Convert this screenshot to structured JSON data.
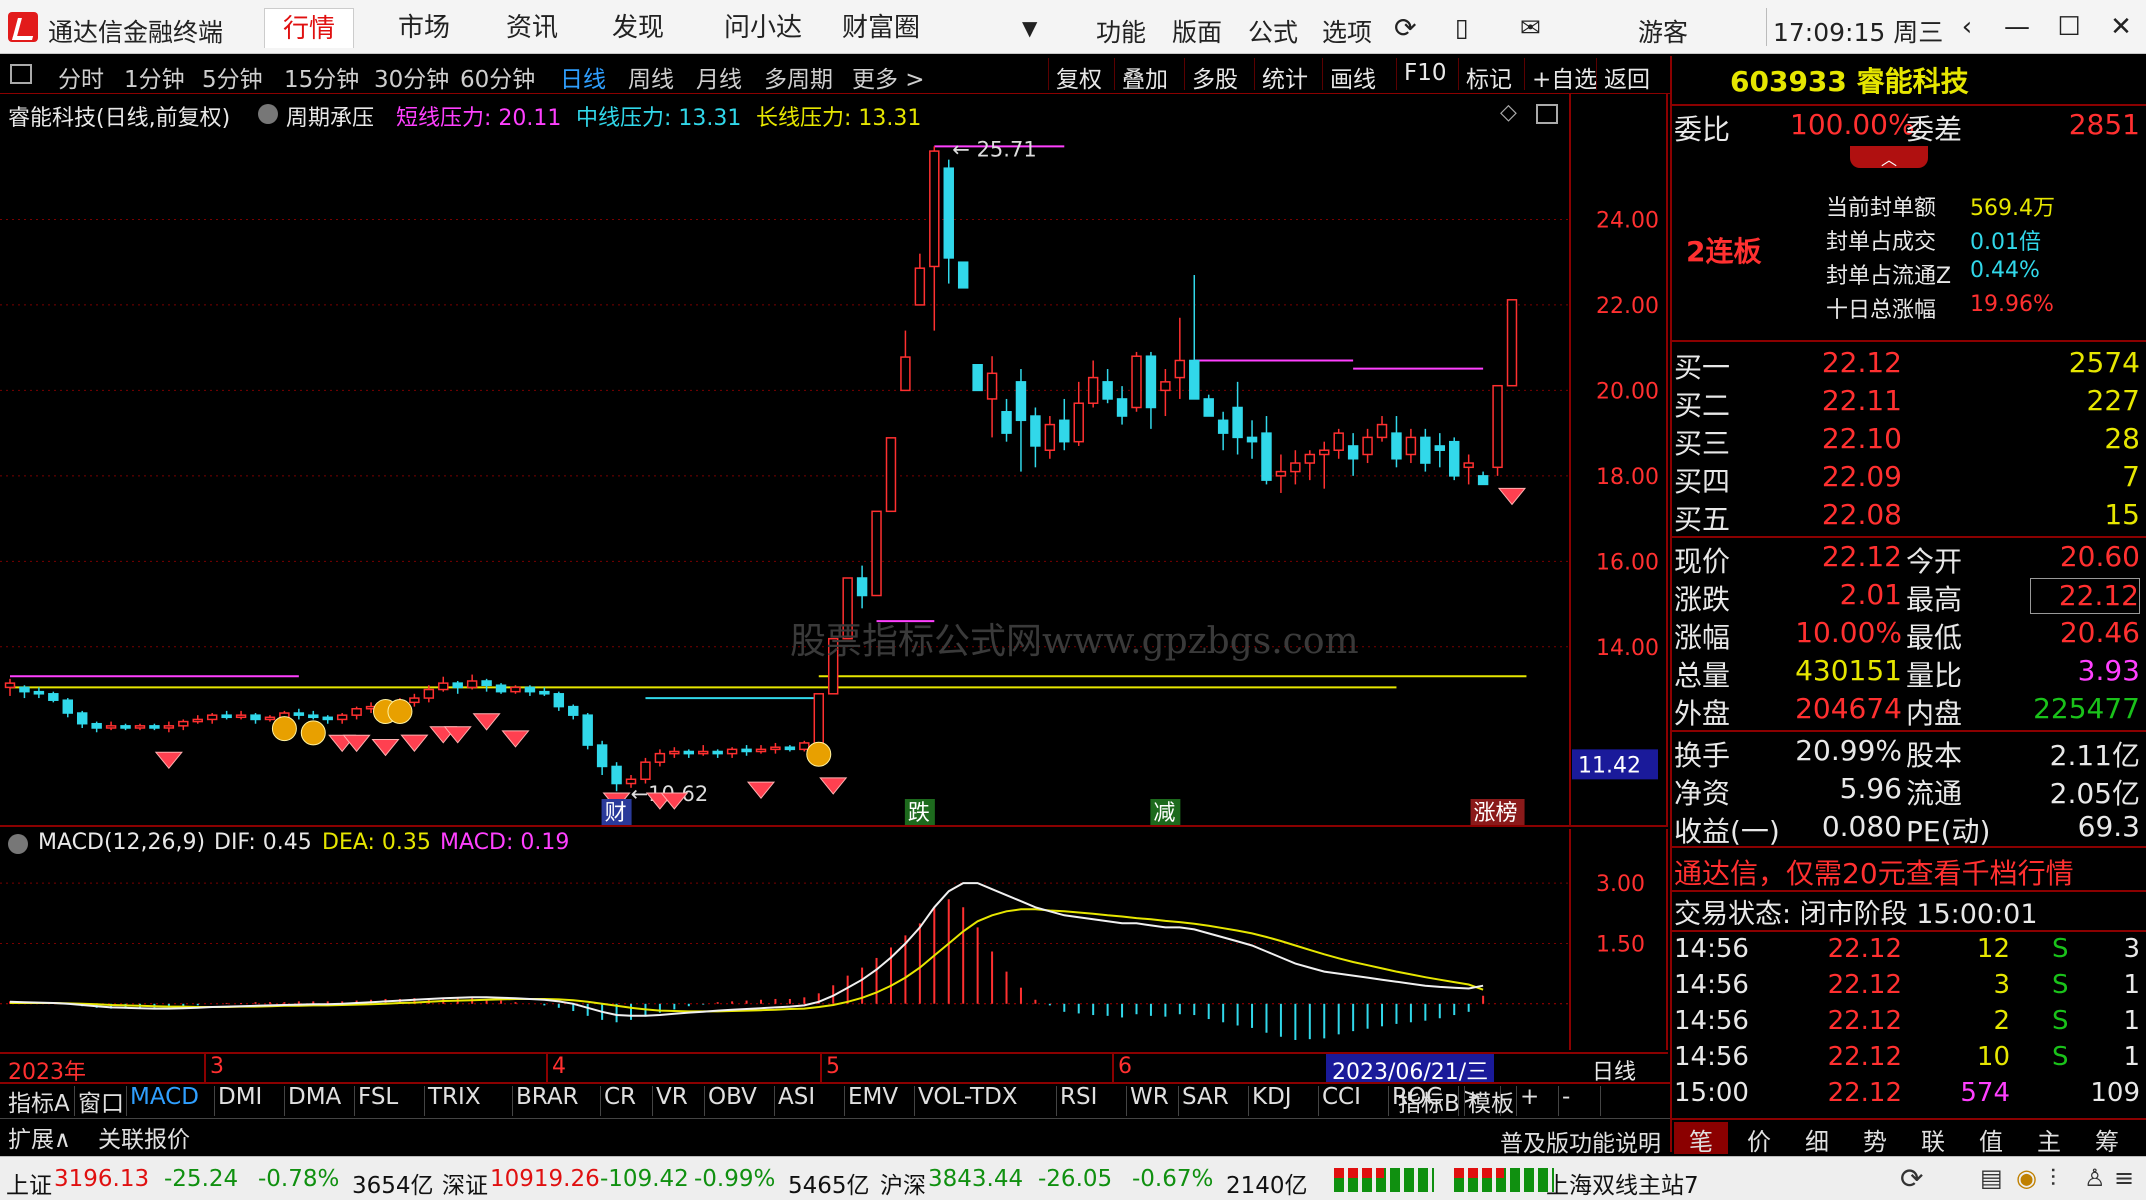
{
  "window": {
    "app_title": "通达信金融终端",
    "menu_tabs": [
      "行情",
      "市场",
      "资讯",
      "发现",
      "问小达",
      "财富圈"
    ],
    "active_tab": "行情",
    "tools": [
      "功能",
      "版面",
      "公式",
      "选项"
    ],
    "user": "游客",
    "clock": "17:09:15 周三"
  },
  "periods": [
    "分时",
    "1分钟",
    "5分钟",
    "15分钟",
    "30分钟",
    "60分钟",
    "日线",
    "周线",
    "月线",
    "多周期",
    "更多 >"
  ],
  "active_period": "日线",
  "toolbar_right": [
    "复权",
    "叠加",
    "多股",
    "统计",
    "画线",
    "F10",
    "标记",
    "+自选",
    "返回"
  ],
  "chart_header": {
    "name": "睿能科技(日线,前复权)",
    "indicator": "周期承压",
    "short_label": "短线压力: 20.11",
    "mid_label": "中线压力: 13.31",
    "long_label": "长线压力: 13.31"
  },
  "chart_data": [
    {
      "type": "candlestick",
      "title": "睿能科技(日线,前复权)",
      "y_ticks": [
        "24.00",
        "22.00",
        "20.00",
        "18.00",
        "16.00",
        "14.00"
      ],
      "ylim": [
        9.9,
        26.0
      ],
      "annotations": {
        "high": "25.71",
        "low": "10.62",
        "current_axis": "11.42"
      },
      "x_ticks": [
        "2023年",
        "3",
        "4",
        "5",
        "6"
      ],
      "cursor_date": "2023/06/21/三",
      "event_tags": [
        "财",
        "跌",
        "减",
        "涨榜"
      ],
      "pressure_lines": {
        "short": 20.11,
        "mid": 13.31,
        "long": 13.31
      },
      "candles": [
        [
          13.05,
          13.15,
          12.85,
          13.25
        ],
        [
          13.05,
          12.95,
          12.8,
          13.1
        ],
        [
          12.95,
          12.9,
          12.8,
          13.05
        ],
        [
          12.9,
          12.75,
          12.7,
          12.95
        ],
        [
          12.75,
          12.45,
          12.35,
          12.8
        ],
        [
          12.45,
          12.2,
          12.1,
          12.5
        ],
        [
          12.2,
          12.1,
          12.0,
          12.25
        ],
        [
          12.1,
          12.15,
          12.05,
          12.25
        ],
        [
          12.15,
          12.1,
          12.05,
          12.2
        ],
        [
          12.1,
          12.15,
          12.05,
          12.2
        ],
        [
          12.15,
          12.1,
          12.05,
          12.2
        ],
        [
          12.1,
          12.15,
          12.0,
          12.25
        ],
        [
          12.15,
          12.25,
          12.05,
          12.3
        ],
        [
          12.25,
          12.3,
          12.2,
          12.4
        ],
        [
          12.3,
          12.4,
          12.2,
          12.45
        ],
        [
          12.4,
          12.35,
          12.3,
          12.5
        ],
        [
          12.35,
          12.4,
          12.3,
          12.5
        ],
        [
          12.4,
          12.3,
          12.2,
          12.45
        ],
        [
          12.3,
          12.35,
          12.25,
          12.4
        ],
        [
          12.35,
          12.45,
          12.3,
          12.5
        ],
        [
          12.45,
          12.4,
          12.3,
          12.55
        ],
        [
          12.4,
          12.35,
          12.3,
          12.5
        ],
        [
          12.35,
          12.3,
          12.2,
          12.4
        ],
        [
          12.3,
          12.4,
          12.2,
          12.45
        ],
        [
          12.4,
          12.55,
          12.3,
          12.6
        ],
        [
          12.55,
          12.6,
          12.45,
          12.7
        ],
        [
          12.6,
          12.55,
          12.45,
          12.65
        ],
        [
          12.55,
          12.7,
          12.5,
          12.8
        ],
        [
          12.7,
          12.8,
          12.6,
          12.9
        ],
        [
          12.8,
          13.0,
          12.7,
          13.1
        ],
        [
          13.0,
          13.15,
          12.95,
          13.3
        ],
        [
          13.15,
          13.05,
          12.9,
          13.2
        ],
        [
          13.05,
          13.2,
          13.0,
          13.35
        ],
        [
          13.2,
          13.1,
          12.95,
          13.25
        ],
        [
          13.1,
          12.95,
          12.9,
          13.15
        ],
        [
          12.95,
          13.05,
          12.9,
          13.1
        ],
        [
          13.05,
          12.95,
          12.85,
          13.1
        ],
        [
          12.95,
          12.9,
          12.85,
          13.05
        ],
        [
          12.9,
          12.6,
          12.5,
          12.95
        ],
        [
          12.6,
          12.4,
          12.3,
          12.65
        ],
        [
          12.4,
          11.7,
          11.6,
          12.45
        ],
        [
          11.7,
          11.2,
          11.0,
          11.8
        ],
        [
          11.2,
          10.8,
          10.62,
          11.3
        ],
        [
          10.8,
          10.9,
          10.7,
          11.0
        ],
        [
          10.9,
          11.3,
          10.8,
          11.4
        ],
        [
          11.3,
          11.5,
          11.2,
          11.6
        ],
        [
          11.5,
          11.55,
          11.4,
          11.65
        ],
        [
          11.55,
          11.5,
          11.4,
          11.6
        ],
        [
          11.5,
          11.55,
          11.45,
          11.7
        ],
        [
          11.55,
          11.5,
          11.4,
          11.6
        ],
        [
          11.5,
          11.6,
          11.4,
          11.65
        ],
        [
          11.6,
          11.55,
          11.45,
          11.7
        ],
        [
          11.55,
          11.6,
          11.5,
          11.7
        ],
        [
          11.6,
          11.65,
          11.5,
          11.75
        ],
        [
          11.65,
          11.6,
          11.55,
          11.7
        ],
        [
          11.6,
          11.75,
          11.55,
          11.8
        ],
        [
          11.75,
          12.9,
          11.7,
          12.9
        ],
        [
          12.9,
          14.19,
          12.9,
          14.19
        ],
        [
          14.19,
          15.61,
          15.61,
          15.61
        ],
        [
          15.61,
          15.2,
          14.9,
          15.9
        ],
        [
          15.2,
          17.17,
          17.17,
          17.17
        ],
        [
          17.17,
          18.89,
          18.89,
          18.89
        ],
        [
          20.0,
          20.78,
          20.3,
          21.4
        ],
        [
          22.0,
          22.86,
          22.0,
          23.2
        ],
        [
          22.9,
          25.6,
          21.4,
          25.71
        ],
        [
          25.2,
          23.1,
          22.5,
          25.4
        ],
        [
          23.0,
          22.4,
          22.4,
          22.4
        ],
        [
          20.6,
          20.0,
          20.0,
          20.0
        ],
        [
          19.8,
          20.4,
          18.9,
          20.8
        ],
        [
          19.5,
          19.0,
          18.8,
          19.8
        ],
        [
          20.2,
          19.3,
          18.1,
          20.5
        ],
        [
          19.4,
          18.7,
          18.2,
          19.6
        ],
        [
          18.6,
          19.2,
          18.4,
          19.4
        ],
        [
          19.3,
          18.8,
          18.6,
          19.8
        ],
        [
          18.8,
          19.7,
          18.7,
          20.2
        ],
        [
          19.7,
          20.3,
          19.6,
          20.7
        ],
        [
          20.2,
          19.8,
          19.7,
          20.5
        ],
        [
          19.8,
          19.4,
          19.2,
          20.1
        ],
        [
          19.6,
          20.8,
          19.5,
          20.9
        ],
        [
          20.8,
          19.6,
          19.1,
          20.9
        ],
        [
          20.0,
          20.2,
          19.4,
          20.5
        ],
        [
          20.3,
          20.7,
          19.8,
          21.7
        ],
        [
          20.7,
          19.8,
          19.8,
          22.7
        ],
        [
          19.8,
          19.4,
          19.4,
          19.9
        ],
        [
          19.3,
          19.0,
          18.6,
          19.5
        ],
        [
          19.6,
          18.9,
          18.5,
          20.2
        ],
        [
          18.9,
          18.8,
          18.4,
          19.3
        ],
        [
          19.0,
          17.9,
          17.8,
          19.4
        ],
        [
          18.0,
          18.1,
          17.6,
          18.5
        ],
        [
          18.1,
          18.3,
          17.8,
          18.6
        ],
        [
          18.3,
          18.5,
          17.9,
          18.6
        ],
        [
          18.5,
          18.6,
          17.7,
          18.8
        ],
        [
          18.6,
          19.0,
          18.4,
          19.1
        ],
        [
          18.7,
          18.4,
          18.0,
          19.0
        ],
        [
          18.5,
          18.9,
          18.3,
          19.1
        ],
        [
          18.9,
          19.2,
          18.8,
          19.4
        ],
        [
          19.0,
          18.4,
          18.2,
          19.4
        ],
        [
          18.5,
          18.9,
          18.3,
          19.1
        ],
        [
          18.9,
          18.3,
          18.1,
          19.1
        ],
        [
          18.7,
          18.6,
          18.2,
          19.0
        ],
        [
          18.8,
          18.0,
          17.9,
          18.9
        ],
        [
          18.2,
          18.3,
          17.8,
          18.5
        ],
        [
          18.0,
          17.8,
          17.8,
          18.1
        ],
        [
          18.2,
          20.11,
          18.0,
          20.11
        ],
        [
          20.11,
          22.12,
          20.46,
          22.12
        ]
      ]
    },
    {
      "type": "line",
      "title": "MACD(12,26,9)",
      "series": [
        {
          "name": "DIF",
          "label": "DIF: 0.45"
        },
        {
          "name": "DEA",
          "label": "DEA: 0.35"
        },
        {
          "name": "MACD",
          "label": "MACD: 0.19"
        }
      ],
      "y_ticks": [
        "3.00",
        "1.50"
      ],
      "ylim": [
        -1.0,
        3.6
      ],
      "dif": [
        0.05,
        0.04,
        0.03,
        0.02,
        0.0,
        -0.03,
        -0.06,
        -0.09,
        -0.1,
        -0.11,
        -0.12,
        -0.12,
        -0.11,
        -0.1,
        -0.08,
        -0.07,
        -0.06,
        -0.05,
        -0.04,
        -0.03,
        -0.02,
        -0.01,
        -0.01,
        0.0,
        0.02,
        0.04,
        0.06,
        0.08,
        0.1,
        0.12,
        0.14,
        0.15,
        0.16,
        0.16,
        0.15,
        0.14,
        0.12,
        0.1,
        0.06,
        0.0,
        -0.1,
        -0.2,
        -0.28,
        -0.3,
        -0.3,
        -0.28,
        -0.25,
        -0.22,
        -0.2,
        -0.17,
        -0.15,
        -0.13,
        -0.11,
        -0.09,
        -0.07,
        -0.04,
        0.05,
        0.2,
        0.4,
        0.6,
        0.85,
        1.15,
        1.5,
        1.9,
        2.4,
        2.8,
        3.0,
        3.0,
        2.85,
        2.7,
        2.55,
        2.4,
        2.3,
        2.2,
        2.15,
        2.1,
        2.05,
        2.0,
        2.0,
        1.95,
        1.9,
        1.9,
        1.85,
        1.75,
        1.65,
        1.55,
        1.45,
        1.3,
        1.15,
        1.0,
        0.9,
        0.8,
        0.75,
        0.7,
        0.65,
        0.6,
        0.55,
        0.5,
        0.45,
        0.42,
        0.4,
        0.38,
        0.45
      ],
      "dea": [
        0.02,
        0.02,
        0.02,
        0.02,
        0.01,
        0.0,
        -0.01,
        -0.03,
        -0.04,
        -0.05,
        -0.06,
        -0.07,
        -0.07,
        -0.08,
        -0.08,
        -0.08,
        -0.07,
        -0.07,
        -0.06,
        -0.05,
        -0.05,
        -0.04,
        -0.04,
        -0.03,
        -0.02,
        -0.01,
        0.0,
        0.02,
        0.03,
        0.05,
        0.07,
        0.08,
        0.09,
        0.1,
        0.11,
        0.12,
        0.12,
        0.12,
        0.11,
        0.09,
        0.05,
        0.0,
        -0.05,
        -0.1,
        -0.14,
        -0.17,
        -0.18,
        -0.19,
        -0.19,
        -0.19,
        -0.18,
        -0.17,
        -0.16,
        -0.15,
        -0.13,
        -0.12,
        -0.08,
        -0.03,
        0.05,
        0.15,
        0.28,
        0.45,
        0.65,
        0.9,
        1.2,
        1.5,
        1.8,
        2.05,
        2.2,
        2.3,
        2.35,
        2.35,
        2.32,
        2.3,
        2.27,
        2.24,
        2.2,
        2.17,
        2.13,
        2.1,
        2.06,
        2.03,
        1.99,
        1.94,
        1.88,
        1.82,
        1.75,
        1.66,
        1.56,
        1.45,
        1.34,
        1.23,
        1.13,
        1.04,
        0.96,
        0.88,
        0.8,
        0.73,
        0.66,
        0.6,
        0.54,
        0.48,
        0.35
      ]
    }
  ],
  "macd_header": {
    "name": "MACD(12,26,9)",
    "dif": "DIF: 0.45",
    "dea": "DEA: 0.35",
    "macd": "MACD: 0.19"
  },
  "watermark": "股票指标公式网www.gpzbgs.com",
  "indicator_tabs": [
    "指标A",
    "窗口",
    "MACD",
    "DMI",
    "DMA",
    "FSL",
    "TRIX",
    "BRAR",
    "CR",
    "VR",
    "OBV",
    "ASI",
    "EMV",
    "VOL-TDX",
    "RSI",
    "WR",
    "SAR",
    "KDJ",
    "CCI",
    "ROC",
    ">",
    "指标B",
    "模板",
    "+",
    "-"
  ],
  "second_row": [
    "扩展∧",
    "关联报价"
  ],
  "second_row_right": "普及版功能说明",
  "axis_right_bottom": "日线",
  "quote": {
    "code_name": "603933 睿能科技",
    "weibi_label": "委比",
    "weibi": "100.00%",
    "weicha_label": "委差",
    "weicha": "2851",
    "lianban": "2连板",
    "seal": [
      [
        "当前封单额",
        "569.4万"
      ],
      [
        "封单占成交",
        "0.01倍"
      ],
      [
        "封单占流通Z",
        "0.44%"
      ],
      [
        "十日总涨幅",
        "19.96%"
      ]
    ],
    "bids": [
      [
        "买一",
        "22.12",
        "2574"
      ],
      [
        "买二",
        "22.11",
        "227"
      ],
      [
        "买三",
        "22.10",
        "28"
      ],
      [
        "买四",
        "22.09",
        "7"
      ],
      [
        "买五",
        "22.08",
        "15"
      ]
    ],
    "stats": [
      [
        "现价",
        "22.12",
        "今开",
        "20.60"
      ],
      [
        "涨跌",
        "2.01",
        "最高",
        "22.12"
      ],
      [
        "涨幅",
        "10.00%",
        "最低",
        "20.46"
      ],
      [
        "总量",
        "430151",
        "量比",
        "3.93"
      ],
      [
        "外盘",
        "204674",
        "内盘",
        "225477"
      ]
    ],
    "stats2": [
      [
        "换手",
        "20.99%",
        "股本",
        "2.11亿"
      ],
      [
        "净资",
        "5.96",
        "流通",
        "2.05亿"
      ],
      [
        "收益(一)",
        "0.080",
        "PE(动)",
        "69.3"
      ]
    ],
    "promo": "通达信，仅需20元查看千档行情",
    "trade_state": "交易状态: 闭市阶段 15:00:01",
    "ticks": [
      [
        "14:56",
        "22.12",
        "12",
        "S",
        "3"
      ],
      [
        "14:56",
        "22.12",
        "3",
        "S",
        "1"
      ],
      [
        "14:56",
        "22.12",
        "2",
        "S",
        "1"
      ],
      [
        "14:56",
        "22.12",
        "10",
        "S",
        "1"
      ],
      [
        "15:00",
        "22.12",
        "574",
        "",
        "109"
      ]
    ],
    "bottom_tabs": [
      "笔",
      "价",
      "细",
      "势",
      "联",
      "值",
      "主",
      "筹"
    ]
  },
  "statusbar": {
    "sh": [
      "上证",
      "3196.13",
      "-25.24",
      "-0.78%",
      "3654亿"
    ],
    "sz": [
      "深证",
      "10919.26",
      "-109.42",
      "-0.99%",
      "5465亿"
    ],
    "hs": [
      "沪深",
      "3843.44",
      "-26.05",
      "-0.67%",
      "2140亿"
    ],
    "server": "上海双线主站7"
  },
  "colors": {
    "up": "#ff3030",
    "down": "#31d8ea",
    "bg": "#000000",
    "border": "#8b0000",
    "short": "#ff40ff",
    "mid": "#31d8ea",
    "long": "#e6e600"
  }
}
